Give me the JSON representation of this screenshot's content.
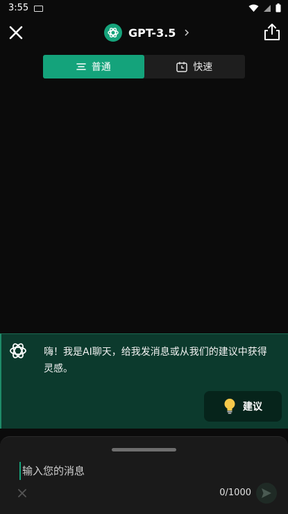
{
  "status_bar": {
    "time": "3:55"
  },
  "header": {
    "model_title": "GPT-3.5"
  },
  "mode_tabs": [
    {
      "label": "普通",
      "active": true
    },
    {
      "label": "快速",
      "active": false
    }
  ],
  "welcome": {
    "message": "嗨！我是AI聊天，给我发消息或从我们的建议中获得灵感。",
    "suggest_label": "建议"
  },
  "composer": {
    "placeholder": "输入您的消息",
    "value": "",
    "counter": "0/1000"
  },
  "colors": {
    "accent": "#14a37b",
    "background": "#0b0b0b",
    "welcome_bg": "#0c3a2d"
  },
  "icons": {
    "close": "close-icon",
    "share": "share-icon",
    "model": "openai-logo-icon",
    "normal_mode": "lines-icon",
    "fast_mode": "clock-icon",
    "suggest": "lightbulb-icon",
    "send": "send-icon"
  }
}
